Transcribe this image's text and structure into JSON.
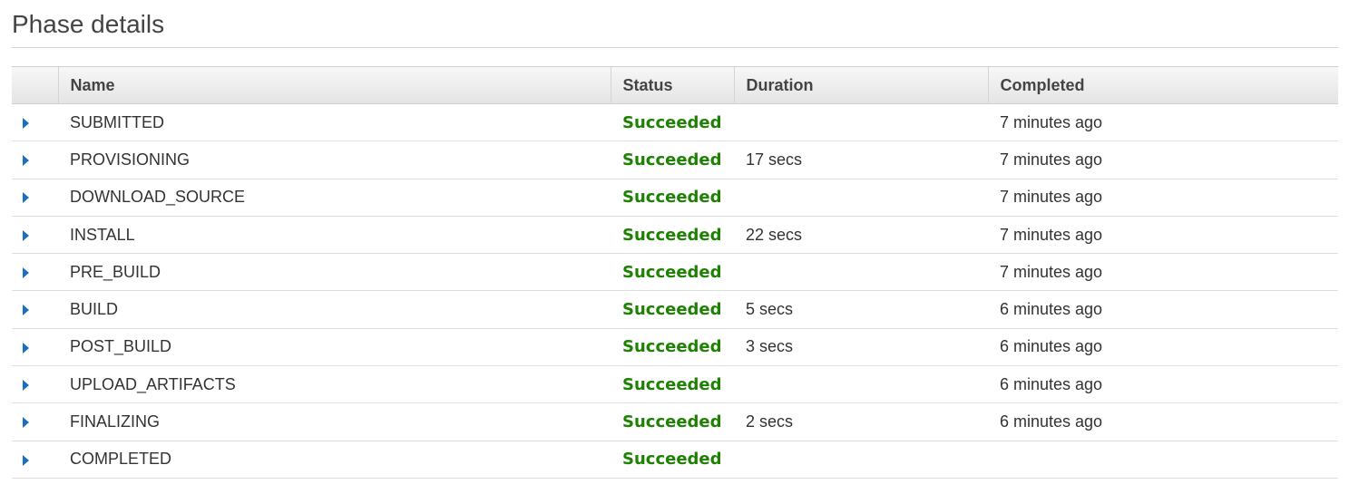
{
  "page": {
    "title": "Phase details"
  },
  "table": {
    "columns": [
      "",
      "Name",
      "Status",
      "Duration",
      "Completed"
    ],
    "rows": [
      {
        "name": "SUBMITTED",
        "status": "Succeeded",
        "duration": "",
        "completed": "7 minutes ago"
      },
      {
        "name": "PROVISIONING",
        "status": "Succeeded",
        "duration": "17 secs",
        "completed": "7 minutes ago"
      },
      {
        "name": "DOWNLOAD_SOURCE",
        "status": "Succeeded",
        "duration": "",
        "completed": "7 minutes ago"
      },
      {
        "name": "INSTALL",
        "status": "Succeeded",
        "duration": "22 secs",
        "completed": "7 minutes ago"
      },
      {
        "name": "PRE_BUILD",
        "status": "Succeeded",
        "duration": "",
        "completed": "7 minutes ago"
      },
      {
        "name": "BUILD",
        "status": "Succeeded",
        "duration": "5 secs",
        "completed": "6 minutes ago"
      },
      {
        "name": "POST_BUILD",
        "status": "Succeeded",
        "duration": "3 secs",
        "completed": "6 minutes ago"
      },
      {
        "name": "UPLOAD_ARTIFACTS",
        "status": "Succeeded",
        "duration": "",
        "completed": "6 minutes ago"
      },
      {
        "name": "FINALIZING",
        "status": "Succeeded",
        "duration": "2 secs",
        "completed": "6 minutes ago"
      },
      {
        "name": "COMPLETED",
        "status": "Succeeded",
        "duration": "",
        "completed": ""
      }
    ]
  },
  "colors": {
    "status_success": "#1d8102",
    "caret": "#1a6fc2"
  },
  "icons": {
    "row_expand": "caret-right-icon"
  }
}
